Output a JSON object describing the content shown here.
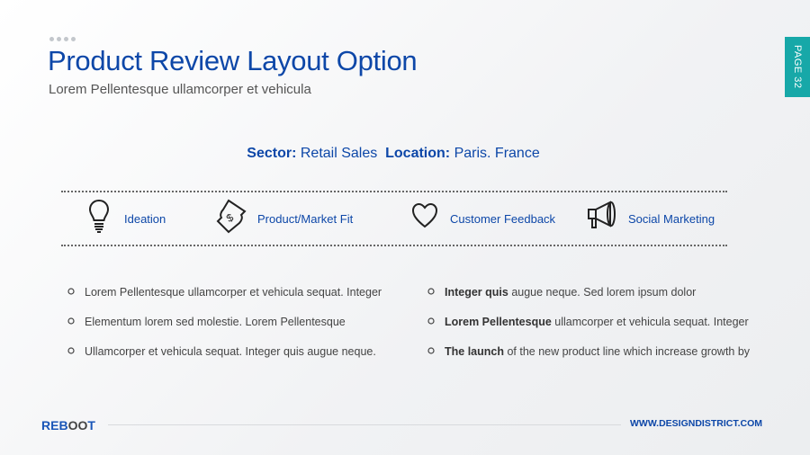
{
  "header": {
    "title": "Product Review Layout Option",
    "subtitle": "Lorem Pellentesque ullamcorper et vehicula",
    "page_tab": "PAGE 32"
  },
  "sector": {
    "sector_label": "Sector:",
    "sector_value": "Retail Sales",
    "location_label": "Location:",
    "location_value": "Paris. France"
  },
  "categories": [
    {
      "icon": "lightbulb-icon",
      "label": "Ideation"
    },
    {
      "icon": "dollar-bill-icon",
      "label": "Product/Market Fit"
    },
    {
      "icon": "heart-icon",
      "label": "Customer Feedback"
    },
    {
      "icon": "megaphone-icon",
      "label": "Social Marketing"
    }
  ],
  "left_bullets": [
    "Lorem Pellentesque ullamcorper et vehicula sequat. Integer",
    "Elementum lorem sed molestie. Lorem Pellentesque",
    "Ullamcorper et vehicula sequat. Integer quis augue neque."
  ],
  "right_bullets": [
    {
      "bold": "Integer quis",
      "text": " augue neque. Sed lorem ipsum dolor"
    },
    {
      "bold": "Lorem Pellentesque",
      "text": " ullamcorper et vehicula sequat. Integer"
    },
    {
      "bold": "The launch",
      "text": " of the new product line which increase growth by"
    }
  ],
  "footer": {
    "logo": "REBOOT",
    "logo_parts": [
      "REB",
      "OO",
      "T"
    ],
    "url": "WWW.DESIGNDISTRICT.COM"
  },
  "colors": {
    "accent": "#0d47a8",
    "page_tab": "#17a8a8"
  }
}
